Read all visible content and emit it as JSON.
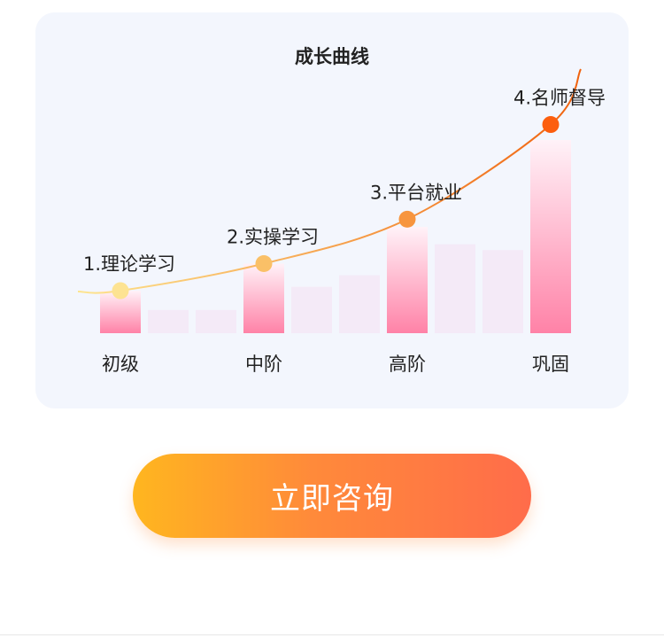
{
  "card": {
    "title": "成长曲线"
  },
  "cta": {
    "label": "立即咨询"
  },
  "chart_data": {
    "type": "bar",
    "title": "成长曲线",
    "bars": [
      {
        "value": 0.22,
        "highlighted": true
      },
      {
        "value": 0.12,
        "highlighted": false
      },
      {
        "value": 0.12,
        "highlighted": false
      },
      {
        "value": 0.36,
        "highlighted": true
      },
      {
        "value": 0.24,
        "highlighted": false
      },
      {
        "value": 0.3,
        "highlighted": false
      },
      {
        "value": 0.55,
        "highlighted": true
      },
      {
        "value": 0.46,
        "highlighted": false
      },
      {
        "value": 0.43,
        "highlighted": false
      },
      {
        "value": 1.0,
        "highlighted": true
      }
    ],
    "categories": [
      {
        "label": "初级",
        "bar_index": 0
      },
      {
        "label": "中阶",
        "bar_index": 3
      },
      {
        "label": "高阶",
        "bar_index": 6
      },
      {
        "label": "巩固",
        "bar_index": 9
      }
    ],
    "milestones": [
      {
        "label": "1.理论学习",
        "bar_index": 0,
        "level": 0.22,
        "color": "#fde392"
      },
      {
        "label": "2.实操学习",
        "bar_index": 3,
        "level": 0.36,
        "color": "#fac067"
      },
      {
        "label": "3.平台就业",
        "bar_index": 6,
        "level": 0.59,
        "color": "#f7953e"
      },
      {
        "label": "4.名师督导",
        "bar_index": 9,
        "level": 1.08,
        "color": "#fc5e0e"
      }
    ],
    "colors": {
      "curve_start": "#fde58f",
      "curve_end": "#f0620e",
      "bar_highlight_top": "#fff2f8",
      "bar_highlight_bottom": "#ff82a7",
      "bar_faint": "#f3e8f6"
    }
  }
}
